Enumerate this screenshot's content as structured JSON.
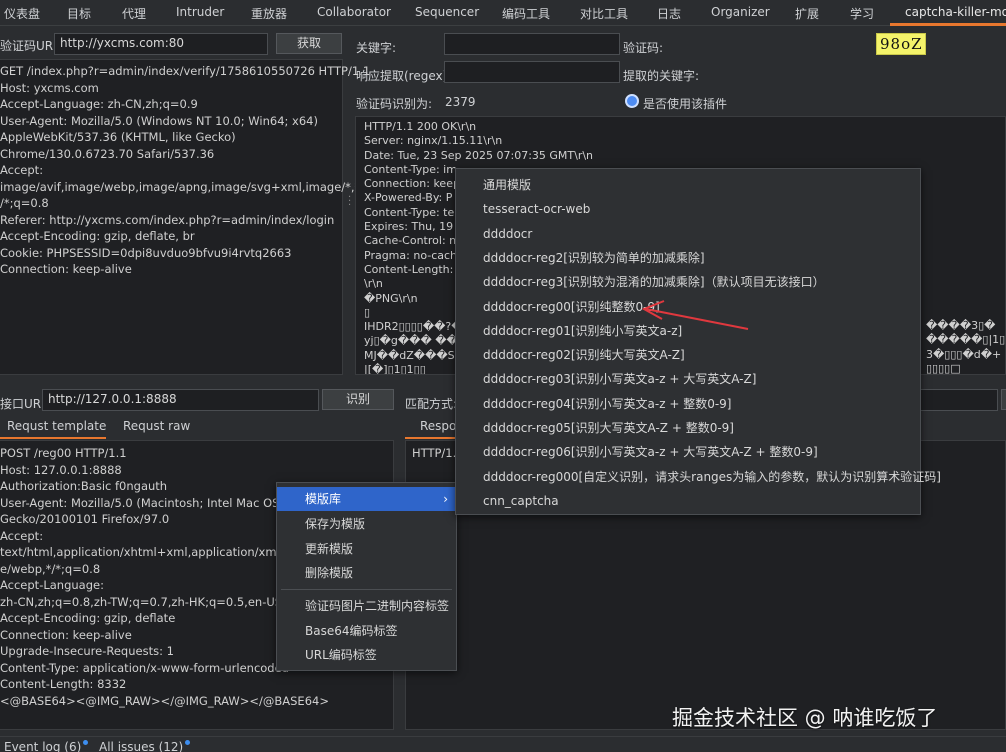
{
  "tabs": [
    "仪表盘",
    "目标",
    "代理",
    "Intruder",
    "重放器",
    "Collaborator",
    "Sequencer",
    "编码工具",
    "对比工具",
    "日志",
    "Organizer",
    "扩展",
    "学习",
    "captcha-killer-mod"
  ],
  "captcha_panel": {
    "url_label": "验证码URL:",
    "url_value": "http://yxcms.com:80",
    "fetch_button": "获取",
    "request_lines": [
      "GET /index.php?r=admin/index/verify/1758610550726 HTTP/1.1",
      "Host: yxcms.com",
      "Accept-Language: zh-CN,zh;q=0.9",
      "User-Agent: Mozilla/5.0 (Windows NT 10.0; Win64; x64)",
      "AppleWebKit/537.36 (KHTML, like Gecko)",
      "Chrome/130.0.6723.70 Safari/537.36",
      "Accept:",
      "image/avif,image/webp,image/apng,image/svg+xml,image/*,*",
      "/*;q=0.8",
      "Referer: http://yxcms.com/index.php?r=admin/index/login",
      "Accept-Encoding: gzip, deflate, br",
      "Cookie: PHPSESSID=0dpi8uvduo9bfvu9i4rvtq2663",
      "Connection: keep-alive"
    ]
  },
  "right_top": {
    "keyword_label": "关键字:",
    "keyword_value": "",
    "regex_label": "响应提取(regex):",
    "regex_value": "",
    "captcha_label": "验证码:",
    "captcha_text": "98oZ",
    "extracted_keyword_label": "提取的关键字:",
    "recognized_label": "验证码识别为:",
    "recognized_value": "2379",
    "use_plugin_label": "是否使用该插件",
    "response_lines": [
      "HTTP/1.1 200 OK\\r\\n",
      "Server: nginx/1.15.11\\r\\n",
      "Date: Tue, 23 Sep 2025 07:07:35 GMT\\r\\n",
      "Content-Type: im",
      "Connection: keep",
      "X-Powered-By: P",
      "Content-Type: te",
      "Expires: Thu, 19 N",
      "Cache-Control: n",
      "Pragma: no-cach",
      "Content-Length:",
      "\\r\\n",
      "�PNG\\r\\n",
      "▯",
      "IHDR2▯▯▯▯��?�",
      "yj▯�g���  ��",
      "MJ��dZ���S",
      "|[�]▯1▯1▯▯"
    ],
    "response_right_lines": [
      "����3▯�",
      "�����▯|1▯堵",
      "3�▯▯▯�d�+",
      "▯▯▯▯□"
    ]
  },
  "api_panel": {
    "url_label": "接口URL:",
    "url_value": "http://127.0.0.1:8888",
    "recognize_button": "识别",
    "match_label": "匹配方式:",
    "tab_template": "Requst template",
    "tab_raw": "Requst raw",
    "tab_response": "Respo",
    "template_lines": [
      "POST /reg00 HTTP/1.1",
      "Host: 127.0.0.1:8888",
      "Authorization:Basic f0ngauth",
      "User-Agent: Mozilla/5.0 (Macintosh; Intel Mac OS X",
      "Gecko/20100101 Firefox/97.0",
      "Accept:",
      "text/html,application/xhtml+xml,application/xml;q=",
      "e/webp,*/*;q=0.8",
      "Accept-Language:",
      "zh-CN,zh;q=0.8,zh-TW;q=0.7,zh-HK;q=0.5,en-US;q=",
      "Accept-Encoding: gzip, deflate",
      "Connection: keep-alive",
      "Upgrade-Insecure-Requests: 1",
      "Content-Type: application/x-www-form-urlencoded",
      "Content-Length: 8332",
      "",
      "<@BASE64><@IMG_RAW></@IMG_RAW></@BASE64>"
    ],
    "response_first_line": "HTTP/1."
  },
  "context_menu": {
    "items": [
      "模版库",
      "保存为模版",
      "更新模版",
      "删除模版",
      "验证码图片二进制内容标签",
      "Base64编码标签",
      "URL编码标签"
    ]
  },
  "submenu": {
    "items": [
      "通用模版",
      "tesseract-ocr-web",
      "ddddocr",
      "ddddocr-reg2[识别较为简单的加减乘除]",
      "ddddocr-reg3[识别较为混淆的加减乘除]（默认项目无该接口）",
      "ddddocr-reg00[识别纯整数0-9]",
      "ddddocr-reg01[识别纯小写英文a-z]",
      "ddddocr-reg02[识别纯大写英文A-Z]",
      "ddddocr-reg03[识别小写英文a-z + 大写英文A-Z]",
      "ddddocr-reg04[识别小写英文a-z + 整数0-9]",
      "ddddocr-reg05[识别大写英文A-Z + 整数0-9]",
      "ddddocr-reg06[识别小写英文a-z + 大写英文A-Z + 整数0-9]",
      "ddddocr-reg000[自定义识别，请求头ranges为输入的参数，默认为识别算术验证码]",
      "cnn_captcha"
    ]
  },
  "bottom_bar": {
    "event_log": "Event log (6)",
    "all_issues": "All issues (12)"
  },
  "watermark": "掘金技术社区 @ 呐谁吃饭了",
  "colors": {
    "accent": "#e8772e",
    "highlight": "#2f65ca",
    "annotation_arrow": "#e0383e",
    "captcha_bg": "#f4f36a"
  }
}
